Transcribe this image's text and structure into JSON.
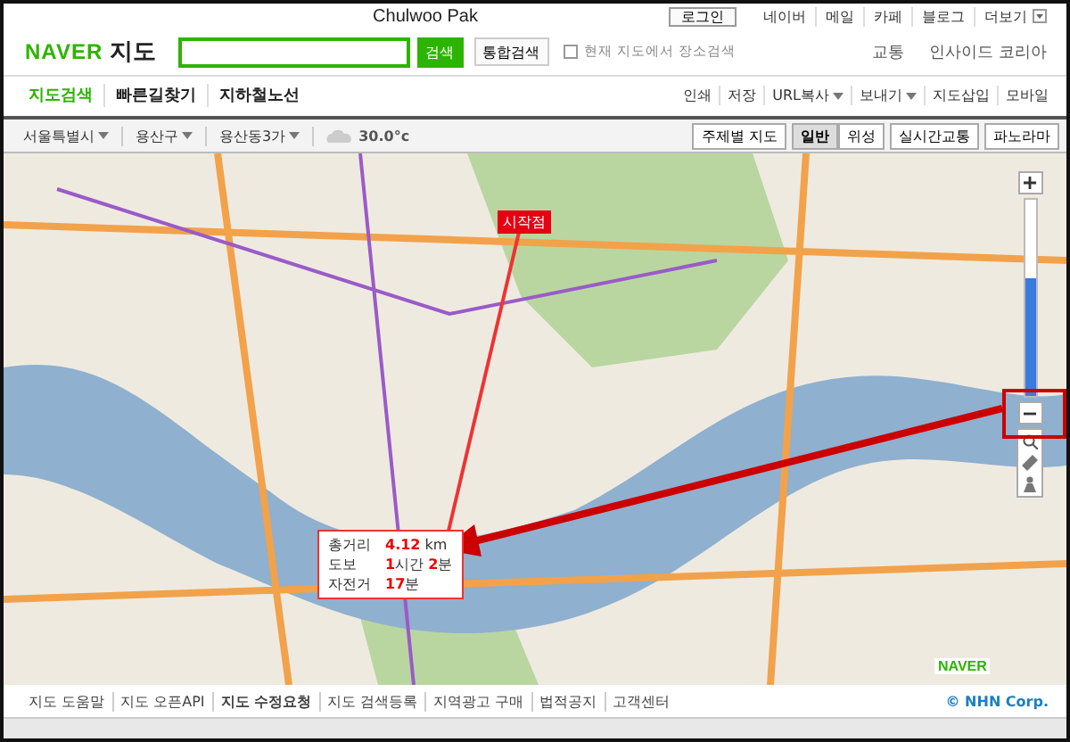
{
  "window": {
    "title": "Chulwoo Pak"
  },
  "login_button": "로그인",
  "top_links": [
    {
      "label": "네이버",
      "dropdown": false
    },
    {
      "label": "메일",
      "dropdown": false
    },
    {
      "label": "카페",
      "dropdown": false
    },
    {
      "label": "블로그",
      "dropdown": false
    },
    {
      "label": "더보기",
      "dropdown": true
    }
  ],
  "logo": {
    "brand": "NAVER",
    "service": "지도"
  },
  "search": {
    "button": "검색",
    "integrated_button": "통합검색",
    "option": {
      "label": "현재 지도에서 장소검색",
      "checked": false
    }
  },
  "header_links": [
    "교통",
    "인사이드 코리아"
  ],
  "tabs": [
    {
      "label": "지도검색",
      "selected": true
    },
    {
      "label": "빠른길찾기",
      "selected": false
    },
    {
      "label": "지하철노선",
      "selected": false
    }
  ],
  "tools": [
    {
      "label": "인쇄",
      "dropdown": false
    },
    {
      "label": "저장",
      "dropdown": false
    },
    {
      "label": "URL복사",
      "dropdown": true
    },
    {
      "label": "보내기",
      "dropdown": true
    },
    {
      "label": "지도삽입",
      "dropdown": false
    },
    {
      "label": "모바일",
      "dropdown": false
    }
  ],
  "breadcrumb": [
    "서울특별시",
    "용산구",
    "용산동3가"
  ],
  "weather": "30.0°c",
  "map_toolbar": {
    "theme_button": "주제별 지도",
    "modes": [
      {
        "label": "일반",
        "selected": true
      },
      {
        "label": "위성",
        "selected": false
      }
    ],
    "buttons": [
      "실시간교통",
      "파노라마"
    ]
  },
  "map": {
    "start_marker": "시작점",
    "zoom": {
      "level": 0.6
    },
    "route_info": [
      {
        "label": "총거리",
        "value": "**4.12** km"
      },
      {
        "label": "도보",
        "value": "**1**시간 **2**분"
      },
      {
        "label": "자전거",
        "value": "**17**분"
      }
    ],
    "map_logo": "NAVER"
  },
  "footer_links": [
    {
      "label": "지도 도움말",
      "emphasized": false
    },
    {
      "label": "지도 오픈API",
      "emphasized": false
    },
    {
      "label": "지도 수정요청",
      "emphasized": true
    },
    {
      "label": "지도 검색등록",
      "emphasized": false
    },
    {
      "label": "지역광고 구매",
      "emphasized": false
    },
    {
      "label": "법적공지",
      "emphasized": false
    },
    {
      "label": "고객센터",
      "emphasized": false
    }
  ],
  "copyright": "© NHN Corp."
}
